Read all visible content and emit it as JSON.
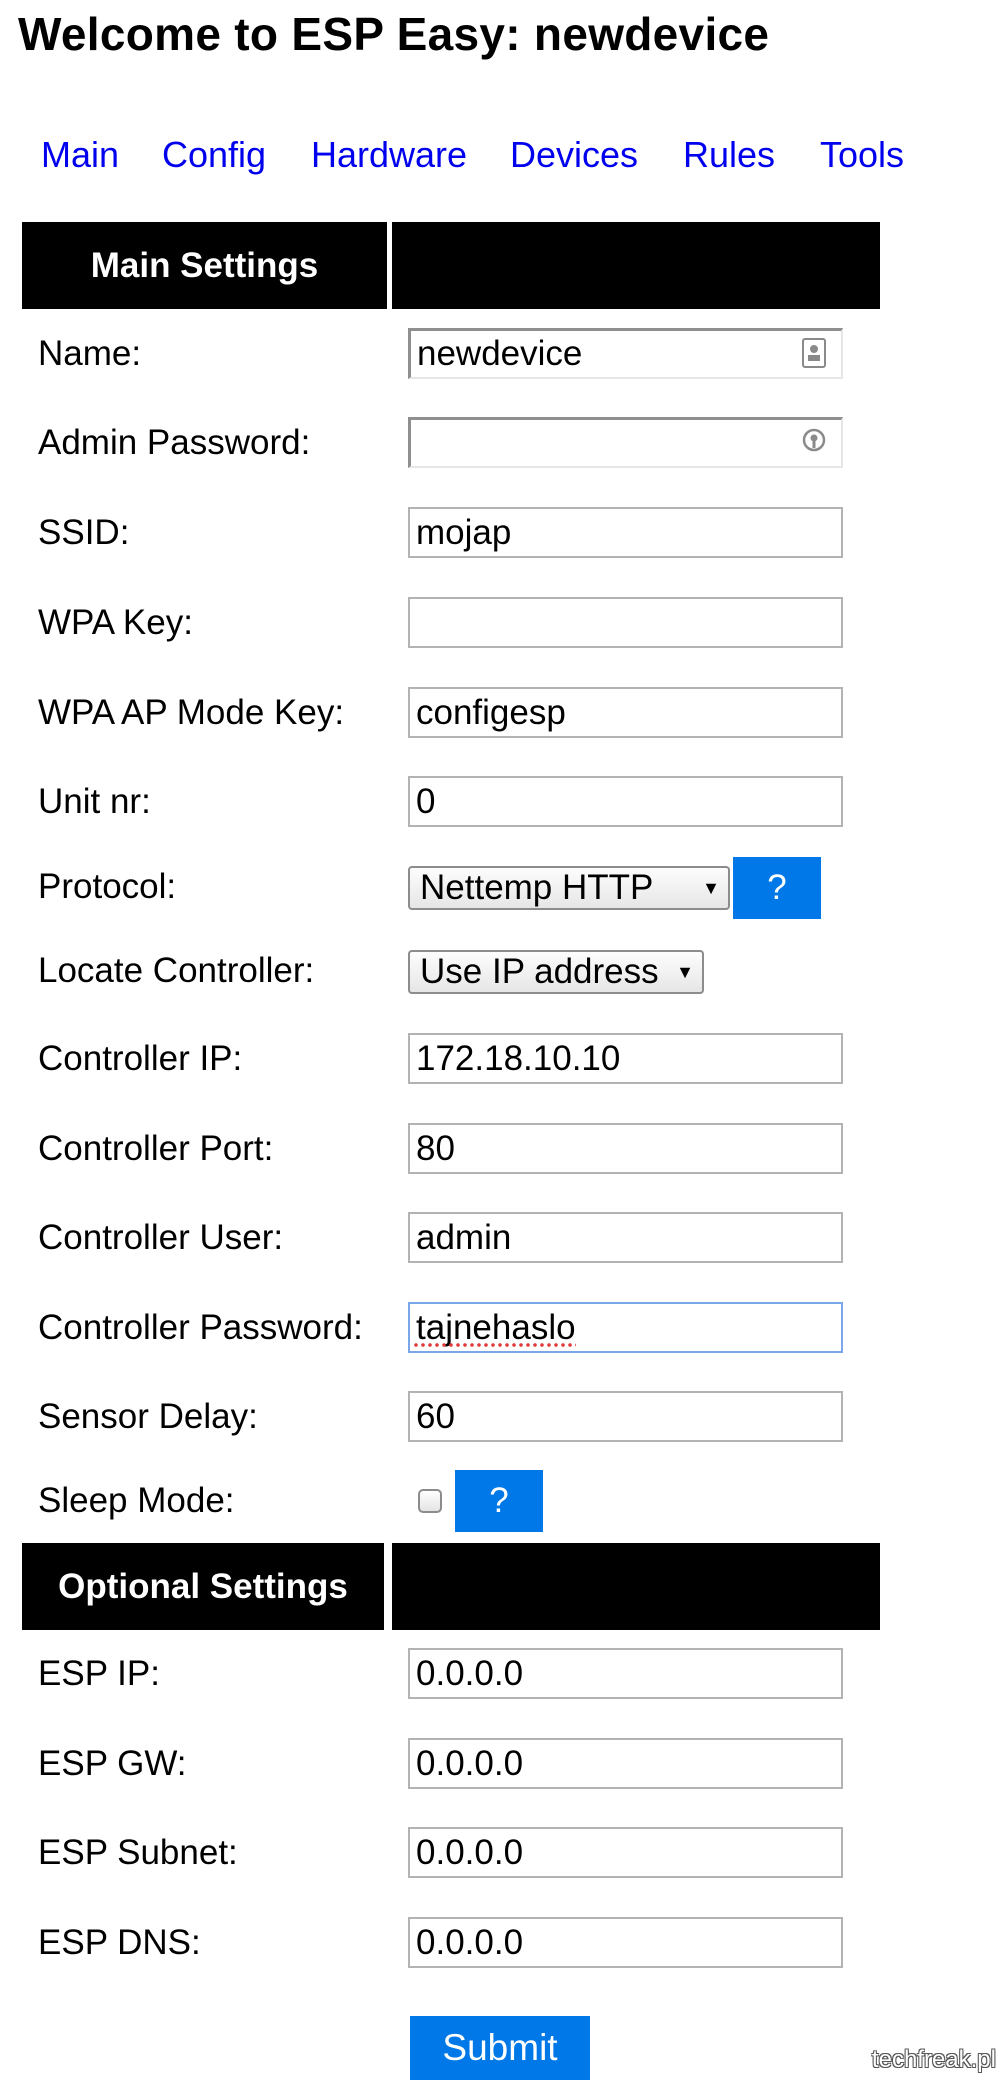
{
  "page_title": "Welcome to ESP Easy: newdevice",
  "nav": {
    "main": "Main",
    "config": "Config",
    "hardware": "Hardware",
    "devices": "Devices",
    "rules": "Rules",
    "tools": "Tools"
  },
  "colors": {
    "link": "#0000ee",
    "header_bg": "#000000",
    "button_blue": "#0078e7"
  },
  "main_settings": {
    "header": "Main Settings",
    "name": {
      "label": "Name:",
      "value": "newdevice"
    },
    "admin_password": {
      "label": "Admin Password:",
      "value": ""
    },
    "ssid": {
      "label": "SSID:",
      "value": "mojap"
    },
    "wpa_key": {
      "label": "WPA Key:",
      "value": ""
    },
    "wpa_ap_mode_key": {
      "label": "WPA AP Mode Key:",
      "value": "configesp"
    },
    "unit_nr": {
      "label": "Unit nr:",
      "value": "0"
    },
    "protocol": {
      "label": "Protocol:",
      "selected": "Nettemp HTTP",
      "help": "?"
    },
    "locate_controller": {
      "label": "Locate Controller:",
      "selected": "Use IP address"
    },
    "controller_ip": {
      "label": "Controller IP:",
      "value": "172.18.10.10"
    },
    "controller_port": {
      "label": "Controller Port:",
      "value": "80"
    },
    "controller_user": {
      "label": "Controller User:",
      "value": "admin"
    },
    "controller_password": {
      "label": "Controller Password:",
      "value": "tajnehaslo"
    },
    "sensor_delay": {
      "label": "Sensor Delay:",
      "value": "60"
    },
    "sleep_mode": {
      "label": "Sleep Mode:",
      "checked": false,
      "help": "?"
    }
  },
  "optional_settings": {
    "header": "Optional Settings",
    "esp_ip": {
      "label": "ESP IP:",
      "value": "0.0.0.0"
    },
    "esp_gw": {
      "label": "ESP GW:",
      "value": "0.0.0.0"
    },
    "esp_subnet": {
      "label": "ESP Subnet:",
      "value": "0.0.0.0"
    },
    "esp_dns": {
      "label": "ESP DNS:",
      "value": "0.0.0.0"
    }
  },
  "submit_label": "Submit",
  "watermark": "techfreak.pl"
}
